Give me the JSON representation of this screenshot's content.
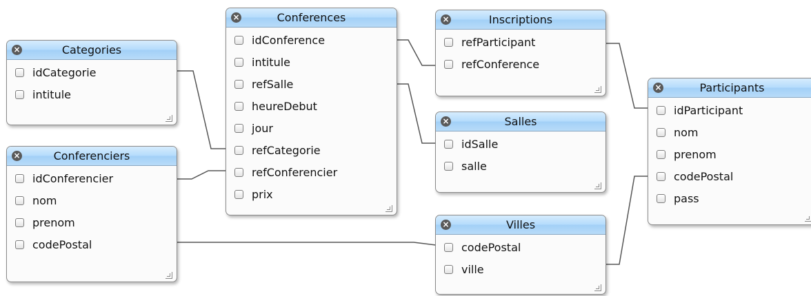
{
  "tables": {
    "categories": {
      "title": "Categories",
      "fields": [
        "idCategorie",
        "intitule"
      ]
    },
    "conferenciers": {
      "title": "Conferenciers",
      "fields": [
        "idConferencier",
        "nom",
        "prenom",
        "codePostal"
      ]
    },
    "conferences": {
      "title": "Conferences",
      "fields": [
        "idConference",
        "intitule",
        "refSalle",
        "heureDebut",
        "jour",
        "refCategorie",
        "refConferencier",
        "prix"
      ]
    },
    "inscriptions": {
      "title": "Inscriptions",
      "fields": [
        "refParticipant",
        "refConference"
      ]
    },
    "salles": {
      "title": "Salles",
      "fields": [
        "idSalle",
        "salle"
      ]
    },
    "villes": {
      "title": "Villes",
      "fields": [
        "codePostal",
        "ville"
      ]
    },
    "participants": {
      "title": "Participants",
      "fields": [
        "idParticipant",
        "nom",
        "prenom",
        "codePostal",
        "pass"
      ]
    }
  },
  "colors": {
    "header": "#b5dcfc",
    "line": "#555555",
    "border": "#8a8a8a"
  }
}
